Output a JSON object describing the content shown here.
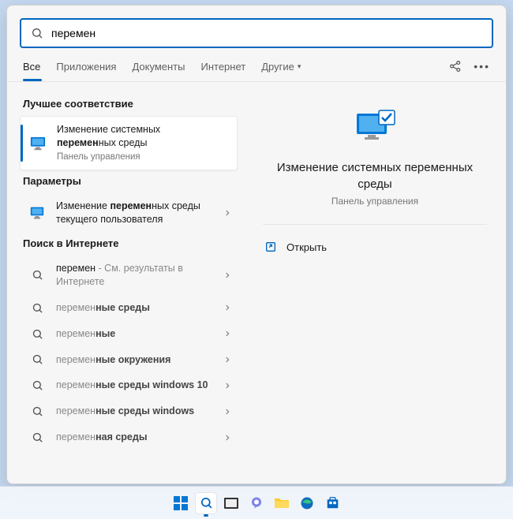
{
  "search": {
    "value": "перемен"
  },
  "tabs": {
    "all": "Все",
    "apps": "Приложения",
    "docs": "Документы",
    "web": "Интернет",
    "more": "Другие"
  },
  "sections": {
    "best": "Лучшее соответствие",
    "params": "Параметры",
    "web": "Поиск в Интернете"
  },
  "best": {
    "line1_pre": "Изменение системных ",
    "line2_b": "перемен",
    "line2_post": "ных среды",
    "sub": "Панель управления"
  },
  "params": {
    "pre": "Изменение ",
    "b": "перемен",
    "post1": "ных среды",
    "post2": "текущего пользователя"
  },
  "websearch": {
    "query": "перемен",
    "hint": " - См. результаты в Интернете",
    "items": [
      {
        "b": "перемен",
        "post": "ные среды"
      },
      {
        "b": "перемен",
        "post": "ные"
      },
      {
        "b": "перемен",
        "post": "ные окружения"
      },
      {
        "b": "перемен",
        "post": "ные среды windows 10"
      },
      {
        "b": "перемен",
        "post": "ные среды windows"
      },
      {
        "b": "перемен",
        "post": "ная среды"
      }
    ]
  },
  "preview": {
    "title": "Изменение системных переменных среды",
    "sub": "Панель управления",
    "open": "Открыть"
  }
}
